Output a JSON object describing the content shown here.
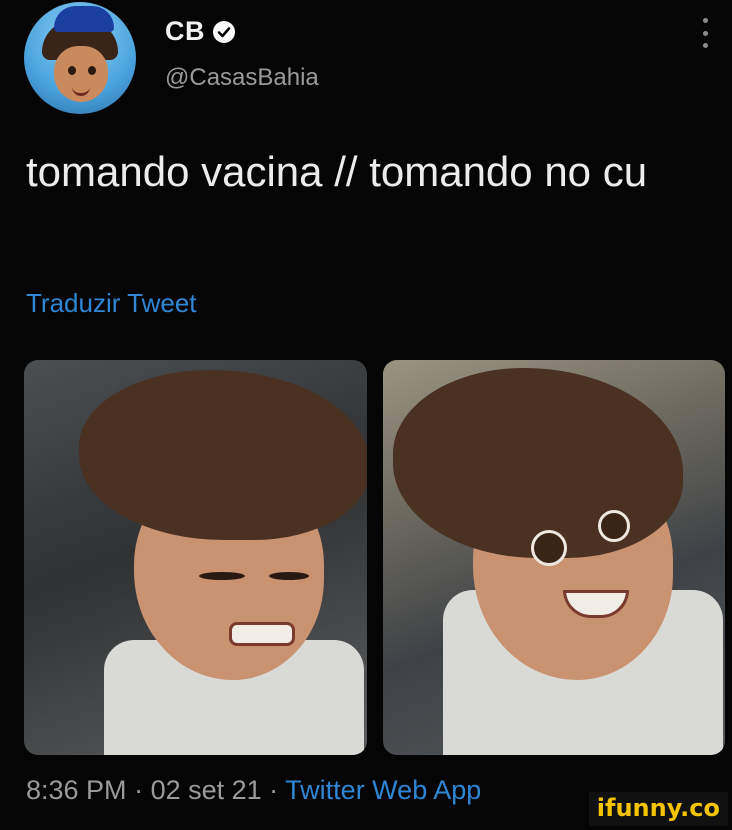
{
  "author": {
    "name": "CB",
    "handle": "@CasasBahia",
    "verified": true,
    "avatar_icon": "profile-avatar"
  },
  "tweet": {
    "text": "tomando vacina // tomando no cu",
    "translate_label": "Traduzir Tweet"
  },
  "media": [
    {
      "description_icon": "cartoon-boy-wincing-image"
    },
    {
      "description_icon": "cartoon-boy-grinning-image"
    }
  ],
  "footer": {
    "time": "8:36 PM",
    "separator": " · ",
    "date": "02 set 21",
    "source": "Twitter Web App"
  },
  "watermark": {
    "text": "ifunny.co"
  },
  "colors": {
    "background": "#050505",
    "link": "#2e86d4",
    "muted": "#9a9a9a",
    "watermark": "#f5c400"
  }
}
